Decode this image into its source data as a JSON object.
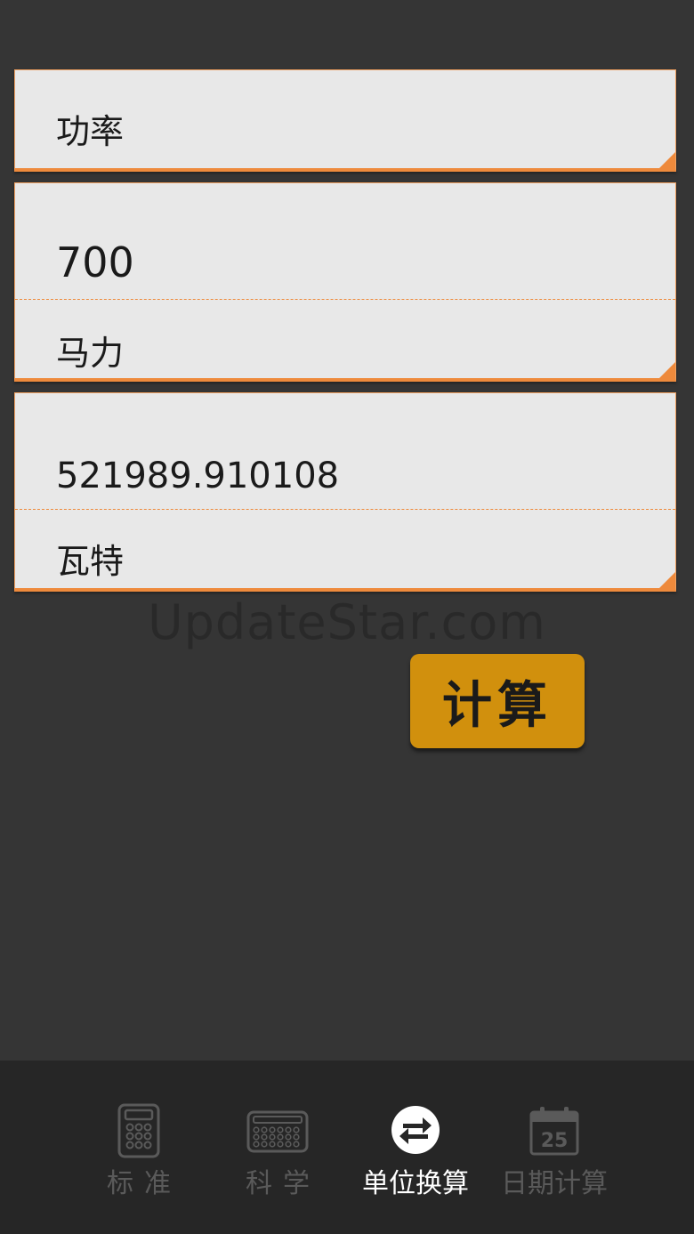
{
  "converter": {
    "category": "功率",
    "input_value": "700",
    "input_unit": "马力",
    "output_value": "521989.910108",
    "output_unit": "瓦特"
  },
  "watermark": "UpdateStar.com",
  "actions": {
    "calculate_label": "计算"
  },
  "tabbar": {
    "tabs": [
      {
        "label": "标准",
        "icon": "calculator-icon",
        "active": false
      },
      {
        "label": "科学",
        "icon": "scientific-keyboard-icon",
        "active": false
      },
      {
        "label": "单位换算",
        "icon": "swap-arrows-icon",
        "active": true
      },
      {
        "label": "日期计算",
        "icon": "calendar-icon",
        "active": false
      }
    ],
    "calendar_day": "25"
  },
  "colors": {
    "accent": "#ee8a3c",
    "button": "#d1900d",
    "background": "#353535",
    "card": "#e8e8e8",
    "tabbar": "#262626"
  }
}
